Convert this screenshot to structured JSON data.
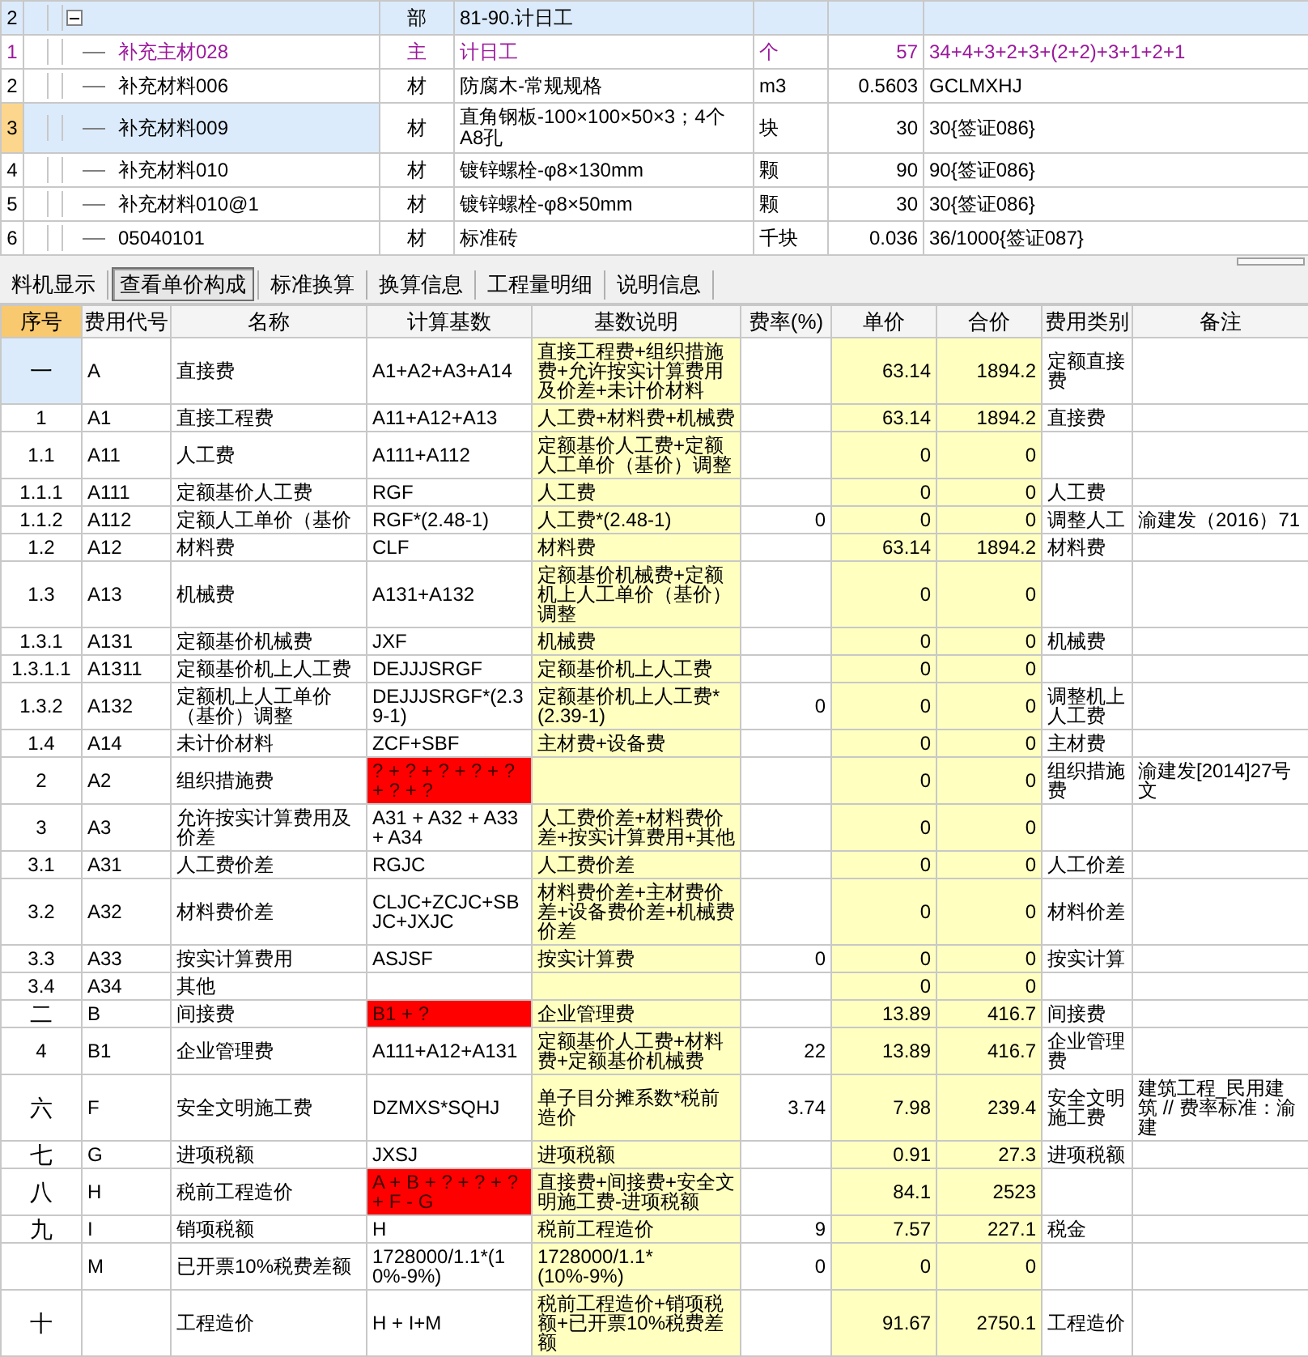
{
  "items_table": {
    "rows": [
      {
        "no": "2",
        "kind": "section",
        "expanded": true,
        "selected": false,
        "name": "",
        "type": "部",
        "spec": "81-90.计日工",
        "unit": "",
        "qty": "",
        "expr": ""
      },
      {
        "no": "1",
        "kind": "main_material",
        "selected": false,
        "name": "补充主材028",
        "type": "主",
        "spec": "计日工",
        "unit": "个",
        "qty": "57",
        "expr": "34+4+3+2+3+(2+2)+3+1+2+1"
      },
      {
        "no": "2",
        "kind": "material",
        "selected": false,
        "name": "补充材料006",
        "type": "材",
        "spec": "防腐木-常规规格",
        "unit": "m3",
        "qty": "0.5603",
        "expr": "GCLMXHJ"
      },
      {
        "no": "3",
        "kind": "material",
        "selected": true,
        "name": "补充材料009",
        "type": "材",
        "spec": "直角钢板-100×100×50×3；4个A8孔",
        "unit": "块",
        "qty": "30",
        "expr": "30{签证086}"
      },
      {
        "no": "4",
        "kind": "material",
        "selected": false,
        "name": "补充材料010",
        "type": "材",
        "spec": "镀锌螺栓-φ8×130mm",
        "unit": "颗",
        "qty": "90",
        "expr": "90{签证086}"
      },
      {
        "no": "5",
        "kind": "material",
        "selected": false,
        "name": "补充材料010@1",
        "type": "材",
        "spec": "镀锌螺栓-φ8×50mm",
        "unit": "颗",
        "qty": "30",
        "expr": "30{签证086}"
      },
      {
        "no": "6",
        "kind": "material",
        "selected": false,
        "name": "05040101",
        "type": "材",
        "spec": "标准砖",
        "unit": "千块",
        "qty": "0.036",
        "expr": "36/1000{签证087}"
      }
    ]
  },
  "tabs": [
    {
      "label": "料机显示",
      "selected": false
    },
    {
      "label": "查看单价构成",
      "selected": true
    },
    {
      "label": "标准换算",
      "selected": false
    },
    {
      "label": "换算信息",
      "selected": false
    },
    {
      "label": "工程量明细",
      "selected": false
    },
    {
      "label": "说明信息",
      "selected": false
    }
  ],
  "cost_table": {
    "columns": [
      {
        "label": "序号",
        "selected": true,
        "highlighted": false
      },
      {
        "label": "费用代号",
        "selected": false,
        "highlighted": false
      },
      {
        "label": "名称",
        "selected": false,
        "highlighted": false
      },
      {
        "label": "计算基数",
        "selected": false,
        "highlighted": false
      },
      {
        "label": "基数说明",
        "selected": false,
        "highlighted": true
      },
      {
        "label": "费率(%)",
        "selected": false,
        "highlighted": false
      },
      {
        "label": "单价",
        "selected": false,
        "highlighted": true
      },
      {
        "label": "合价",
        "selected": false,
        "highlighted": true
      },
      {
        "label": "费用类别",
        "selected": false,
        "highlighted": false
      },
      {
        "label": "备注",
        "selected": false,
        "highlighted": false
      }
    ],
    "rows": [
      {
        "selected": true,
        "base_error": false,
        "cells": [
          "一",
          "A",
          "直接费",
          "A1+A2+A3+A14",
          "直接工程费+组织措施费+允许按实计算费用及价差+未计价材料",
          "",
          "63.14",
          "1894.2",
          "定额直接费",
          ""
        ]
      },
      {
        "selected": false,
        "base_error": false,
        "cells": [
          "1",
          "A1",
          "直接工程费",
          "A11+A12+A13",
          "人工费+材料费+机械费",
          "",
          "63.14",
          "1894.2",
          "直接费",
          ""
        ]
      },
      {
        "selected": false,
        "base_error": false,
        "cells": [
          "1.1",
          "A11",
          "人工费",
          "A111+A112",
          "定额基价人工费+定额人工单价（基价）调整",
          "",
          "0",
          "0",
          "",
          ""
        ]
      },
      {
        "selected": false,
        "base_error": false,
        "cells": [
          "1.1.1",
          "A111",
          "定额基价人工费",
          "RGF",
          "人工费",
          "",
          "0",
          "0",
          "人工费",
          ""
        ]
      },
      {
        "selected": false,
        "base_error": false,
        "cells": [
          "1.1.2",
          "A112",
          "定额人工单价（基价",
          "RGF*(2.48-1)",
          "人工费*(2.48-1)",
          "0",
          "0",
          "0",
          "调整人工",
          "渝建发（2016）71"
        ]
      },
      {
        "selected": false,
        "base_error": false,
        "cells": [
          "1.2",
          "A12",
          "材料费",
          "CLF",
          "材料费",
          "",
          "63.14",
          "1894.2",
          "材料费",
          ""
        ]
      },
      {
        "selected": false,
        "base_error": false,
        "cells": [
          "1.3",
          "A13",
          "机械费",
          "A131+A132",
          "定额基价机械费+定额机上人工单价（基价）调整",
          "",
          "0",
          "0",
          "",
          ""
        ]
      },
      {
        "selected": false,
        "base_error": false,
        "cells": [
          "1.3.1",
          "A131",
          "定额基价机械费",
          "JXF",
          "机械费",
          "",
          "0",
          "0",
          "机械费",
          ""
        ]
      },
      {
        "selected": false,
        "base_error": false,
        "cells": [
          "1.3.1.1",
          "A1311",
          "定额基价机上人工费",
          "DEJJJSRGF",
          "定额基价机上人工费",
          "",
          "0",
          "0",
          "",
          ""
        ]
      },
      {
        "selected": false,
        "base_error": false,
        "cells": [
          "1.3.2",
          "A132",
          "定额机上人工单价（基价）调整",
          "DEJJJSRGF*(2.39-1)",
          "定额基价机上人工费*(2.39-1)",
          "0",
          "0",
          "0",
          "调整机上人工费",
          ""
        ]
      },
      {
        "selected": false,
        "base_error": false,
        "cells": [
          "1.4",
          "A14",
          "未计价材料",
          "ZCF+SBF",
          "主材费+设备费",
          "",
          "0",
          "0",
          "主材费",
          ""
        ]
      },
      {
        "selected": false,
        "base_error": true,
        "cells": [
          "2",
          "A2",
          "组织措施费",
          "? + ? + ? + ? + ? + ? + ?",
          "",
          "",
          "0",
          "0",
          "组织措施费",
          "渝建发[2014]27号文"
        ]
      },
      {
        "selected": false,
        "base_error": false,
        "cells": [
          "3",
          "A3",
          "允许按实计算费用及价差",
          "A31 + A32 + A33 + A34",
          "人工费价差+材料费价差+按实计算费用+其他",
          "",
          "0",
          "0",
          "",
          ""
        ]
      },
      {
        "selected": false,
        "base_error": false,
        "cells": [
          "3.1",
          "A31",
          "人工费价差",
          "RGJC",
          "人工费价差",
          "",
          "0",
          "0",
          "人工价差",
          ""
        ]
      },
      {
        "selected": false,
        "base_error": false,
        "cells": [
          "3.2",
          "A32",
          "材料费价差",
          "CLJC+ZCJC+SBJC+JXJC",
          "材料费价差+主材费价差+设备费价差+机械费价差",
          "",
          "0",
          "0",
          "材料价差",
          ""
        ]
      },
      {
        "selected": false,
        "base_error": false,
        "cells": [
          "3.3",
          "A33",
          "按实计算费用",
          "ASJSF",
          "按实计算费",
          "0",
          "0",
          "0",
          "按实计算",
          ""
        ]
      },
      {
        "selected": false,
        "base_error": false,
        "cells": [
          "3.4",
          "A34",
          "其他",
          "",
          "",
          "",
          "0",
          "0",
          "",
          ""
        ]
      },
      {
        "selected": false,
        "base_error": true,
        "cells": [
          "二",
          "B",
          "间接费",
          "B1 + ?",
          "企业管理费",
          "",
          "13.89",
          "416.7",
          "间接费",
          ""
        ]
      },
      {
        "selected": false,
        "base_error": false,
        "cells": [
          "4",
          "B1",
          "企业管理费",
          "A111+A12+A131",
          "定额基价人工费+材料费+定额基价机械费",
          "22",
          "13.89",
          "416.7",
          "企业管理费",
          ""
        ]
      },
      {
        "selected": false,
        "base_error": false,
        "cells": [
          "六",
          "F",
          "安全文明施工费",
          "DZMXS*SQHJ",
          "单子目分摊系数*税前造价",
          "3.74",
          "7.98",
          "239.4",
          "安全文明施工费",
          "建筑工程_民用建筑 // 费率标准：渝建"
        ]
      },
      {
        "selected": false,
        "base_error": false,
        "cells": [
          "七",
          "G",
          "进项税额",
          "JXSJ",
          "进项税额",
          "",
          "0.91",
          "27.3",
          "进项税额",
          ""
        ]
      },
      {
        "selected": false,
        "base_error": true,
        "cells": [
          "八",
          "H",
          "税前工程造价",
          "A + B + ? + ? + ? + F - G",
          "直接费+间接费+安全文明施工费-进项税额",
          "",
          "84.1",
          "2523",
          "",
          ""
        ]
      },
      {
        "selected": false,
        "base_error": false,
        "cells": [
          "九",
          "I",
          "销项税额",
          "H",
          "税前工程造价",
          "9",
          "7.57",
          "227.1",
          "税金",
          ""
        ]
      },
      {
        "selected": false,
        "base_error": false,
        "cells": [
          "",
          "M",
          "已开票10%税费差额",
          "1728000/1.1*(10%-9%)",
          "1728000/1.1*(10%-9%)",
          "0",
          "0",
          "0",
          "",
          ""
        ]
      },
      {
        "selected": false,
        "base_error": false,
        "cells": [
          "十",
          "",
          "工程造价",
          "H + I+M",
          "税前工程造价+销项税额+已开票10%税费差额",
          "",
          "91.67",
          "2750.1",
          "工程造价",
          ""
        ]
      }
    ]
  }
}
